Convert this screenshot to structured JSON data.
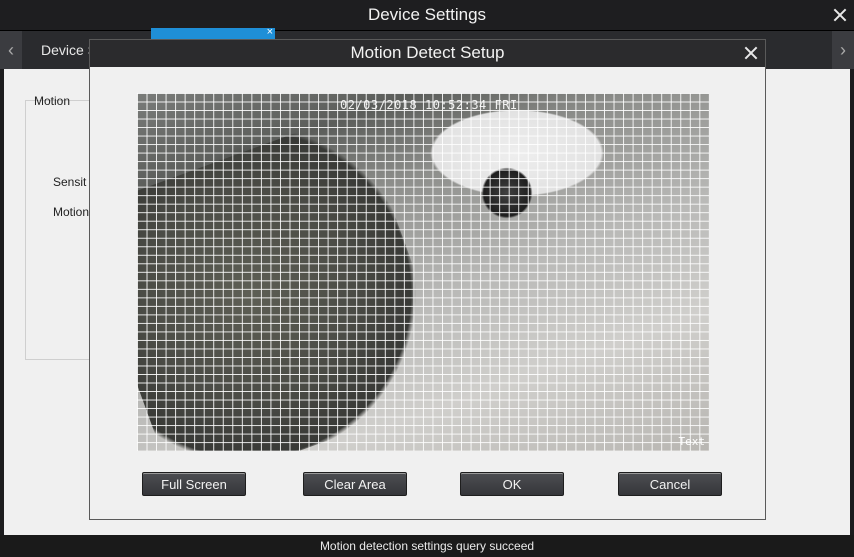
{
  "outer_window": {
    "title": "Device Settings",
    "tab_label": "Device S",
    "tab_close": "×",
    "nav_left": "‹",
    "nav_right": "›"
  },
  "background_panel": {
    "group_label": "Motion",
    "sensitivity_label": "Sensit",
    "motion_label": "Motion"
  },
  "modal": {
    "title": "Motion Detect Setup",
    "video": {
      "timestamp": "02/03/2018 10:52:34 FRI",
      "camera_label": "Text",
      "grid": {
        "columns": 60,
        "rows": 42
      }
    },
    "buttons": {
      "full_screen": "Full Screen",
      "clear_area": "Clear Area",
      "ok": "OK",
      "cancel": "Cancel"
    }
  },
  "status_bar": {
    "message": "Motion detection settings query succeed"
  },
  "colors": {
    "title_bar": "#1e1e20",
    "accent_tab": "#1f8fd7",
    "dialog_bg": "#f0f0f0",
    "button_bg": "#3f4044"
  },
  "icons": [
    "close-icon",
    "chevron-left-icon",
    "chevron-right-icon"
  ]
}
